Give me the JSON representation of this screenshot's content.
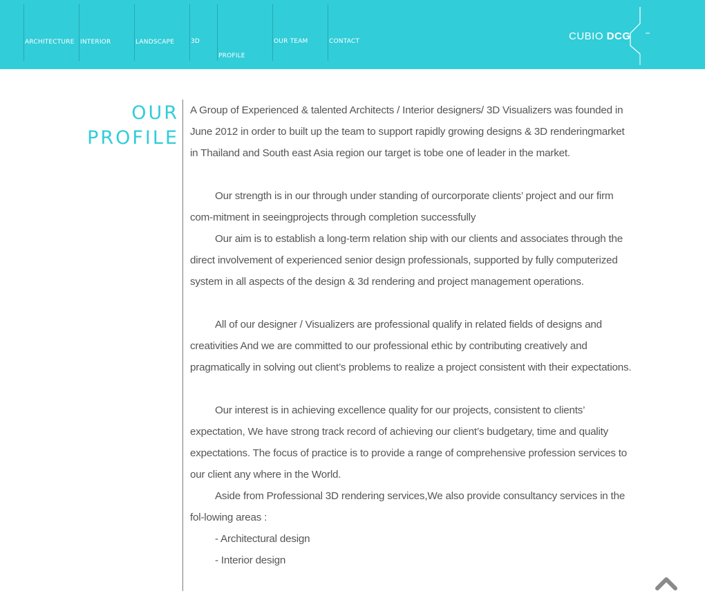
{
  "nav": [
    {
      "label": "ARCHITECTURE"
    },
    {
      "label": "INTERIOR"
    },
    {
      "label": "LANDSCAPE"
    },
    {
      "label": "3D"
    },
    {
      "label": "PROFILE"
    },
    {
      "label": "OUR TEAM"
    },
    {
      "label": "CONTACT"
    }
  ],
  "brand": {
    "prefix": "CUBIO",
    "bold": "DCG"
  },
  "colors": {
    "accent": "#31cdd9",
    "text": "#555555"
  },
  "page": {
    "title_line1": "OUR",
    "title_line2": "PROFILE"
  },
  "content": {
    "p1": "A Group of Experienced & talented Architects / Interior designers/ 3D Visualizers was founded in June 2012 in order to built up the team to support rapidly growing designs & 3D renderingmarket in Thailand and South east Asia region our target is tobe one of leader in the market.",
    "p2": "Our strength is in our through under standing of ourcorporate clients’ project and our firm com-mitment in seeingprojects through completion successfully",
    "p3": "Our aim is to establish a long-term relation ship with our clients and associates through the direct involvement of experienced senior design professionals, supported by fully computerized system in all aspects of the design & 3d rendering and project management operations.",
    "p4": "All of our designer / Visualizers are professional qualify in related fields of designs and creativities And we are committed to our professional ethic by contributing creatively and pragmatically in solving out client’s problems to realize a project consistent with their expectations.",
    "p5": "Our interest is in achieving excellence quality for our projects, consistent to clients’ expectation, We have strong track record of achieving our client’s budgetary, time and quality expectations. The focus of practice is to provide a range of comprehensive profession services to our client any where in the World.",
    "p6": "Aside from Professional 3D rendering services,We also provide consultancy services in the fol-lowing areas :",
    "list": [
      "- Architectural design",
      "- Interior design"
    ]
  },
  "icons": {
    "logo": "cubio-logo-icon",
    "scroll_top": "chevron-up-icon"
  }
}
